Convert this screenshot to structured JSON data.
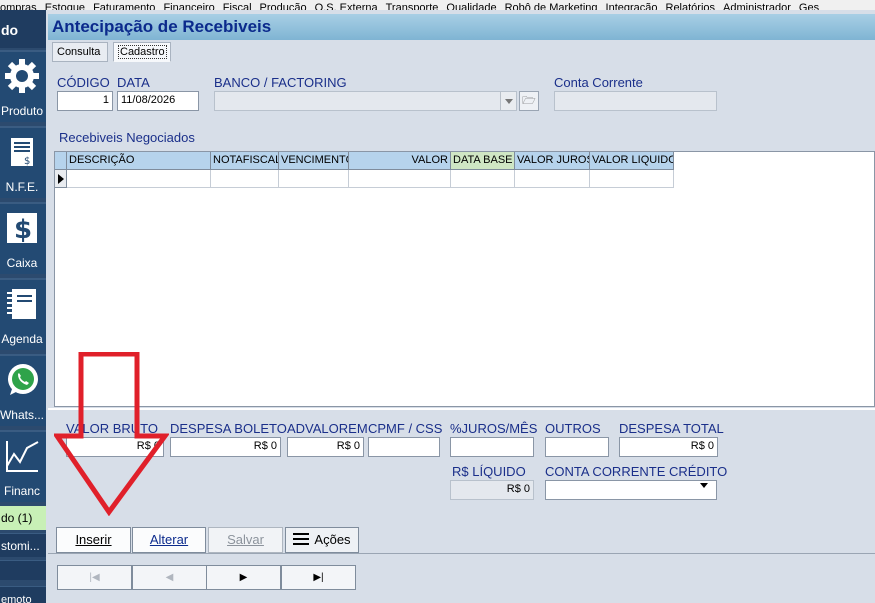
{
  "menu": [
    "ompras",
    "Estoque",
    "Faturamento",
    "Financeiro",
    "Fiscal",
    "Produção",
    "O.S. Externa",
    "Transporte",
    "Qualidade",
    "Robô de Marketing",
    "Integração",
    "Relatórios",
    "Administrador",
    "Ges"
  ],
  "sidebar": {
    "top_label": "do",
    "tiles": [
      {
        "label": "Produto",
        "icon": "gear-icon"
      },
      {
        "label": "N.F.E.",
        "icon": "invoice-icon"
      },
      {
        "label": "Caixa",
        "icon": "dollar-icon"
      },
      {
        "label": "Agenda",
        "icon": "notebook-icon"
      },
      {
        "label": "Whats...",
        "icon": "whatsapp-icon"
      },
      {
        "label": "Financ",
        "icon": "line-chart-icon"
      }
    ],
    "green_item": "do (1)",
    "dark_item_1": "stomi...",
    "dark_item_2": "emoto"
  },
  "window": {
    "title": "Antecipação de Recebiveis"
  },
  "tabs": [
    {
      "label": "Consulta"
    },
    {
      "label": "Cadastro"
    }
  ],
  "form": {
    "codigo_label": "CÓDIGO",
    "codigo_value": "1",
    "data_label": "DATA",
    "data_value": "11/08/2026",
    "banco_label": "BANCO / FACTORING",
    "banco_value": "",
    "conta_label": "Conta Corrente",
    "conta_value": ""
  },
  "grid": {
    "title": "Recebiveis Negociados",
    "columns": [
      "DESCRIÇÃO",
      "NOTAFISCAL",
      "VENCIMENTO",
      "VALOR",
      "DATA BASE",
      "VALOR JUROS",
      "VALOR LIQUIDO"
    ]
  },
  "totals": {
    "valor_bruto_label": "VALOR BRUTO",
    "valor_bruto": "R$ 0",
    "despesa_boleto_label": "DESPESA BOLETO",
    "despesa_boleto": "R$ 0",
    "advalorem_label": "ADVALOREM",
    "advalorem": "R$ 0",
    "cpmf_label": "CPMF / CSS",
    "cpmf": "",
    "juros_label": "%JUROS/MÊS",
    "juros": "",
    "outros_label": "OUTROS",
    "outros": "",
    "despesa_total_label": "DESPESA TOTAL",
    "despesa_total": "R$ 0",
    "liquido_label": "R$ LÍQUIDO",
    "liquido": "R$ 0",
    "conta_credito_label": "CONTA CORRENTE CRÉDITO",
    "conta_credito": ""
  },
  "actions": {
    "inserir": "Inserir",
    "alterar": "Alterar",
    "salvar": "Salvar",
    "acoes": "Ações"
  },
  "nav": {
    "first": "|◀",
    "prev": "◀",
    "next": "▶",
    "last": "▶|"
  },
  "colors": {
    "title_bg": "#8fc0dc",
    "title_text": "#0b2a8c",
    "sidebar_bg": "#2c4a6e",
    "annotation": "#e0202a"
  }
}
